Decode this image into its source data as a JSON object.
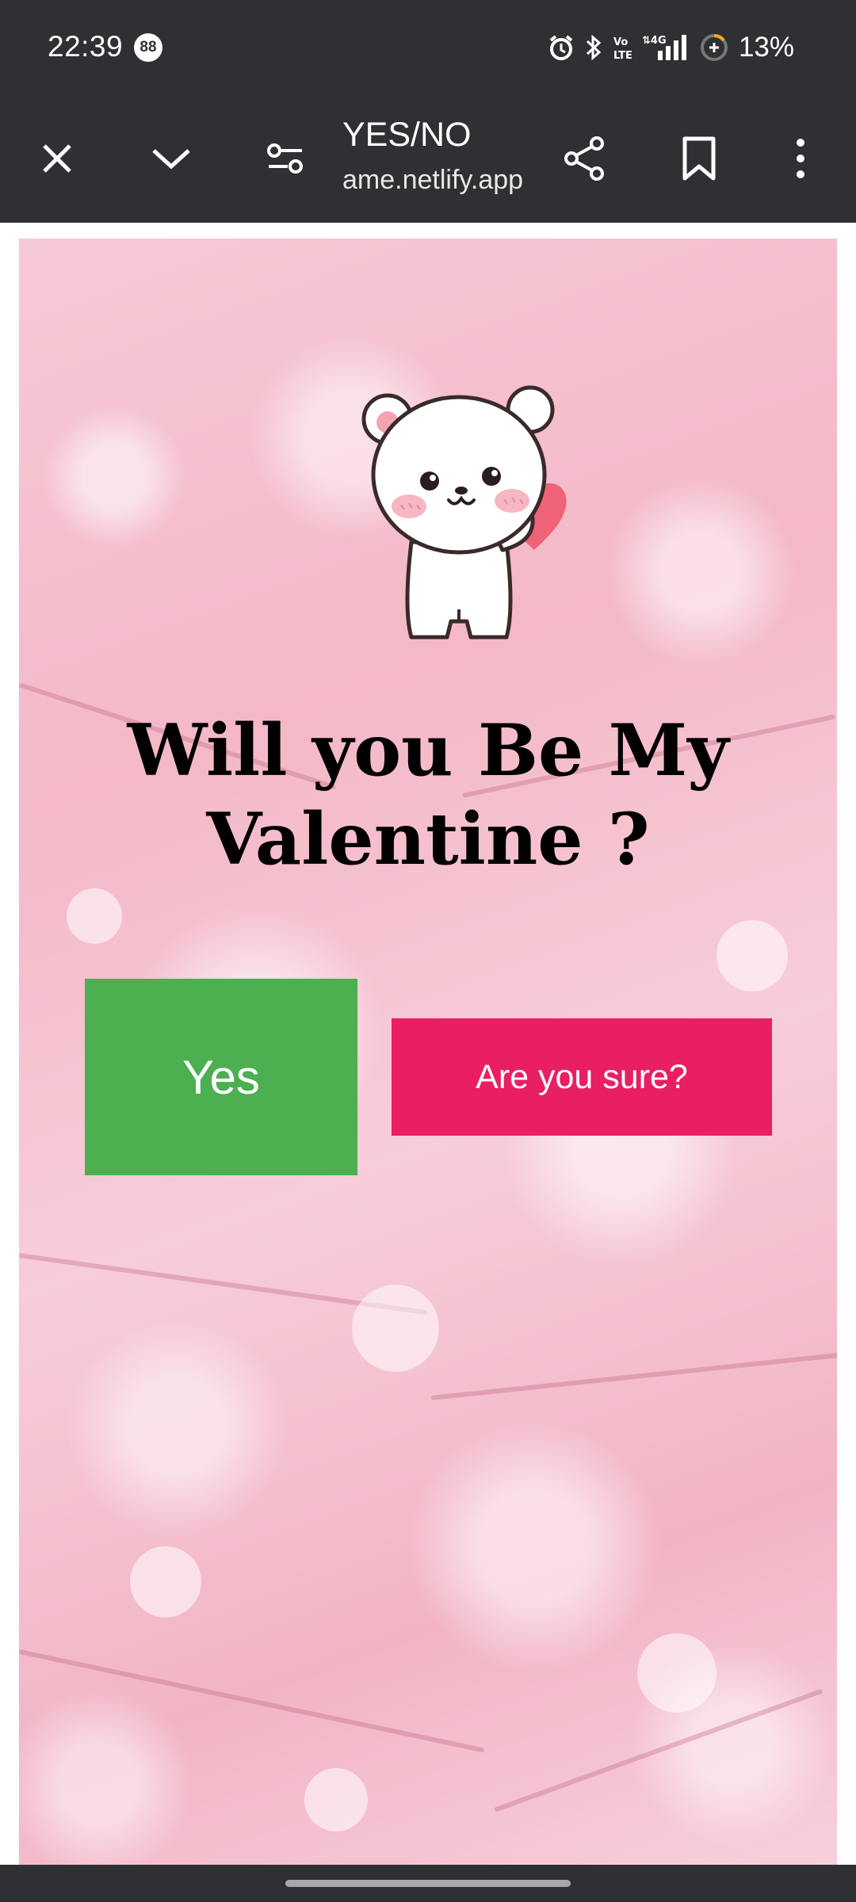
{
  "status_bar": {
    "time": "22:39",
    "notification_count": "88",
    "battery_percent": "13%",
    "icons": [
      "alarm-icon",
      "bluetooth-icon",
      "volte-icon",
      "4g-signal-icon",
      "battery-saver-icon"
    ]
  },
  "toolbar": {
    "title": "YES/NO",
    "url": "ame.netlify.app",
    "icons": [
      "close-icon",
      "chevron-down-icon",
      "page-settings-icon",
      "share-icon",
      "bookmark-icon",
      "more-icon"
    ]
  },
  "page": {
    "headline": "Will you Be My Valentine ?",
    "yes_button": "Yes",
    "no_button": "Are you sure?"
  },
  "colors": {
    "chrome": "#2f3034",
    "yes": "#4caf50",
    "no": "#e91e63",
    "background_pink": "#f6c9d6"
  }
}
